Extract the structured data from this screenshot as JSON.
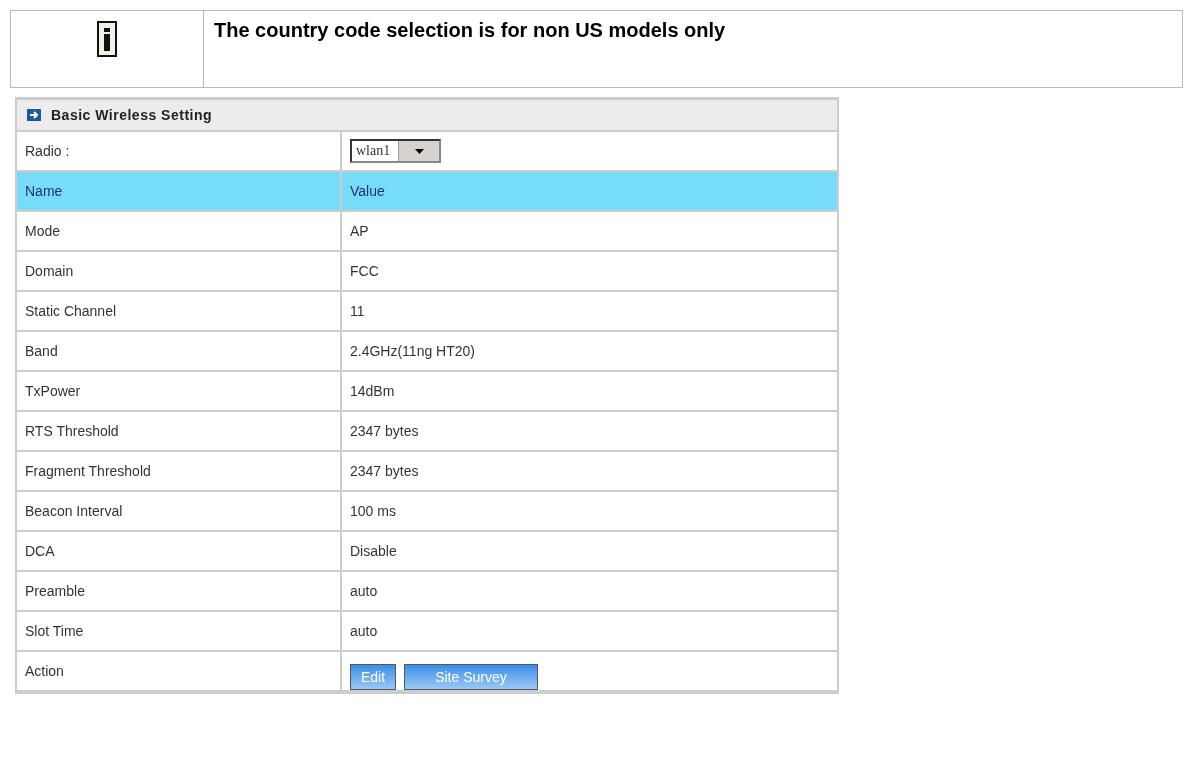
{
  "note": {
    "text": "The country code selection is for non US models only"
  },
  "panel": {
    "title": "Basic Wireless Setting",
    "radio": {
      "label": "Radio :",
      "value": "wlan1"
    },
    "columns": [
      "Name",
      "Value"
    ],
    "rows": [
      {
        "name": "Mode",
        "value": "AP"
      },
      {
        "name": "Domain",
        "value": "FCC"
      },
      {
        "name": "Static Channel",
        "value": "11"
      },
      {
        "name": "Band",
        "value": "2.4GHz(11ng HT20)"
      },
      {
        "name": "TxPower",
        "value": "14dBm"
      },
      {
        "name": "RTS Threshold",
        "value": "2347 bytes"
      },
      {
        "name": "Fragment Threshold",
        "value": "2347 bytes"
      },
      {
        "name": "Beacon Interval",
        "value": "100 ms"
      },
      {
        "name": "DCA",
        "value": "Disable"
      },
      {
        "name": "Preamble",
        "value": "auto"
      },
      {
        "name": "Slot Time",
        "value": "auto"
      }
    ],
    "action": {
      "label": "Action",
      "buttons": [
        "Edit",
        "Site Survey"
      ]
    }
  }
}
